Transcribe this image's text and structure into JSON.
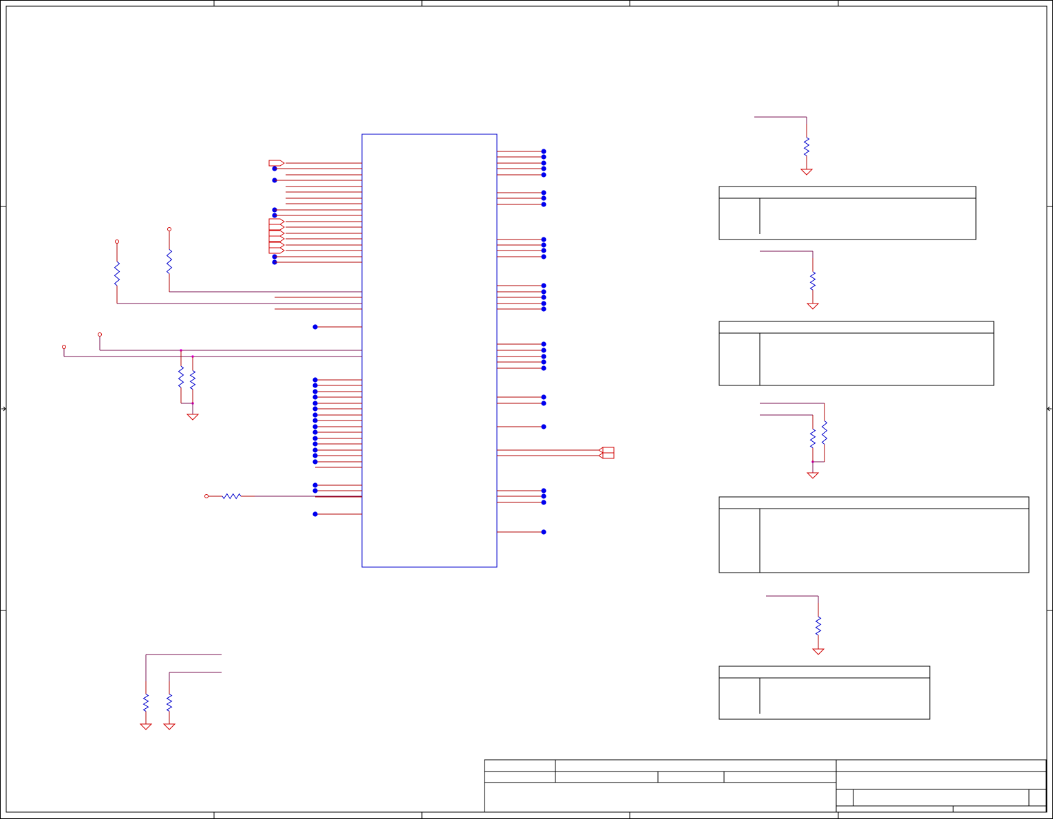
{
  "sheet": {
    "title_block": {
      "cells": [
        "",
        "",
        "",
        "",
        "",
        "",
        "",
        "",
        "",
        ""
      ]
    },
    "config_tables": [
      {
        "rows": []
      },
      {
        "rows": []
      },
      {
        "rows": []
      },
      {
        "rows": []
      }
    ]
  },
  "colors": {
    "wire": "#b00000",
    "net": "#7a1050",
    "component": "#0000cc",
    "junction": "#0000ee",
    "power": "#d00000",
    "frame": "#000000",
    "tee_dot": "#e000e0"
  },
  "icons": {
    "resistor": "resistor-icon",
    "ground": "ground-icon",
    "power_pin": "power-pin-icon",
    "port": "port-arrow-icon",
    "junction": "junction-dot-icon"
  }
}
